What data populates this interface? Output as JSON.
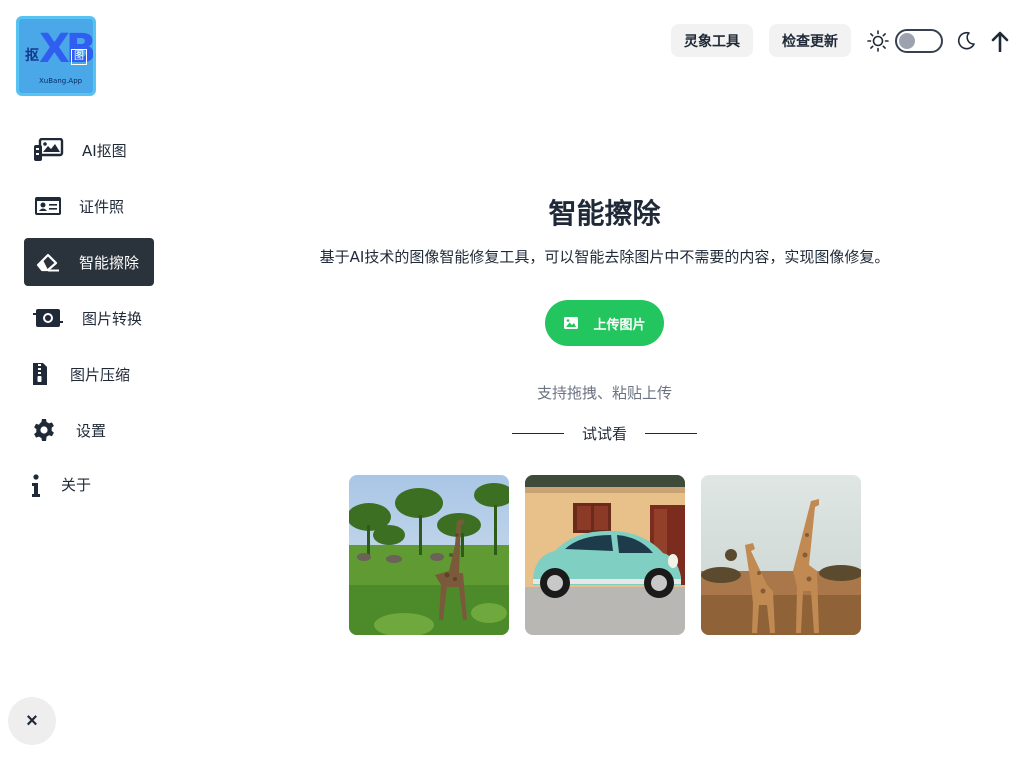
{
  "logo": {
    "left_text": "抠",
    "main_text": "XB",
    "right_text": "图",
    "sub_text": "XuBang.App"
  },
  "sidebar": {
    "items": [
      {
        "label": "AI抠图",
        "icon": "images-icon"
      },
      {
        "label": "证件照",
        "icon": "id-card-icon"
      },
      {
        "label": "智能擦除",
        "icon": "eraser-icon",
        "active": true
      },
      {
        "label": "图片转换",
        "icon": "convert-icon"
      },
      {
        "label": "图片压缩",
        "icon": "file-zip-icon"
      },
      {
        "label": "设置",
        "icon": "gear-icon"
      },
      {
        "label": "关于",
        "icon": "info-icon"
      }
    ]
  },
  "header": {
    "btn_tools": "灵象工具",
    "btn_update": "检查更新",
    "theme_icon_light": "sun-icon",
    "theme_icon_dark": "moon-icon",
    "scroll_top_icon": "arrow-up-icon"
  },
  "main": {
    "title": "智能擦除",
    "description": "基于AI技术的图像智能修复工具，可以智能去除图片中不需要的内容，实现图像修复。",
    "upload_label": "上传图片",
    "hint": "支持拖拽、粘贴上传",
    "try_label": "试试看"
  },
  "samples": [
    {
      "icon": "giraffe-savanna-photo"
    },
    {
      "icon": "vintage-car-photo"
    },
    {
      "icon": "two-giraffes-photo"
    }
  ],
  "close_label": "×",
  "colors": {
    "accent": "#22c55e",
    "active_nav": "#2a323c",
    "button_bg": "#f2f2f2"
  }
}
